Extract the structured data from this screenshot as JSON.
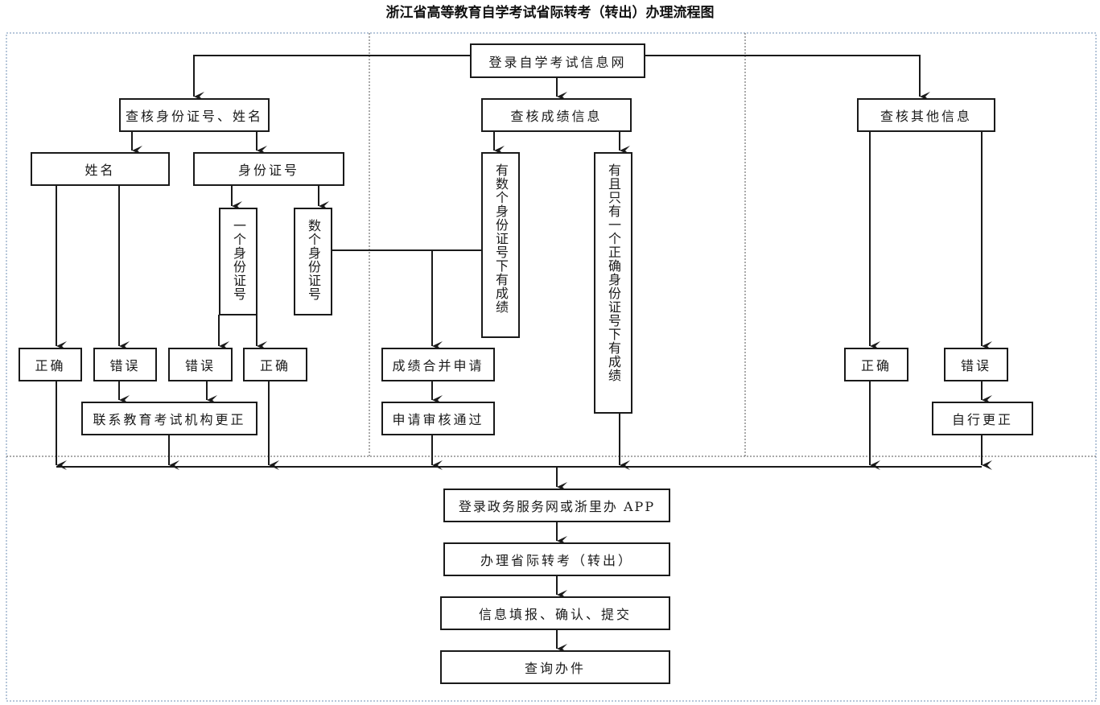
{
  "title": "浙江省高等教育自学考试省际转考（转出）办理流程图",
  "colors": {
    "line": "#1a1a1a",
    "region_border": "#6f8fb5",
    "divider": "#555555"
  },
  "nodes": {
    "login_exam_site": "登录自学考试信息网",
    "check_id_name": "查核身份证号、姓名",
    "check_scores": "查核成绩信息",
    "check_other": "查核其他信息",
    "name": "姓名",
    "id_number": "身份证号",
    "one_id": "一个身份证号",
    "multiple_ids": "数个身份证号",
    "scores_under_multiple_ids": "有数个身份证号下有成绩",
    "scores_under_one_correct_id": "有且只有一个正确身份证号下有成绩",
    "name_correct": "正确",
    "name_wrong": "错误",
    "id_wrong": "错误",
    "id_correct": "正确",
    "contact_exam_office": "联系教育考试机构更正",
    "merge_scores_application": "成绩合并申请",
    "application_approved": "申请审核通过",
    "other_correct": "正确",
    "other_wrong": "错误",
    "self_correct": "自行更正",
    "login_gov_service": "登录政务服务网或浙里办 APP",
    "handle_transfer": "办理省际转考（转出）",
    "fill_confirm_submit": "信息填报、确认、提交",
    "query_case": "查询办件"
  }
}
